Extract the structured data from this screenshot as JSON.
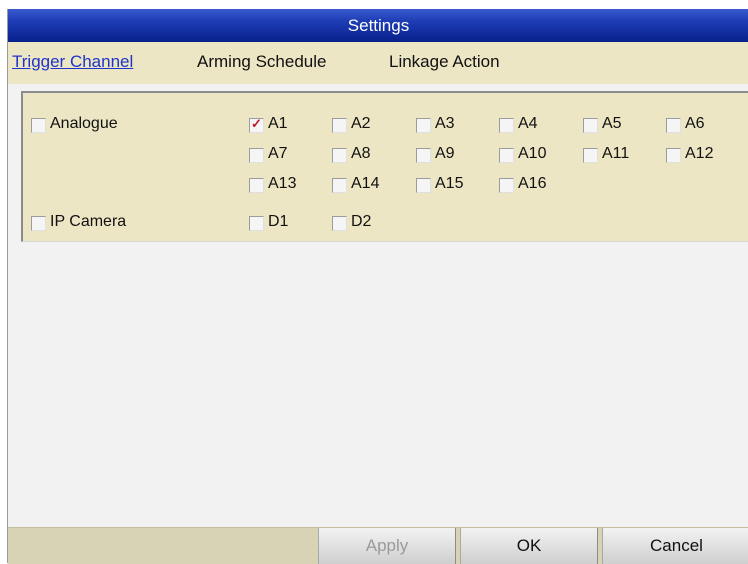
{
  "window": {
    "title": "Settings"
  },
  "tabs": [
    {
      "label": "Trigger Channel",
      "active": true
    },
    {
      "label": "Arming Schedule",
      "active": false
    },
    {
      "label": "Linkage Action",
      "active": false
    }
  ],
  "analogue": {
    "label": "Analogue",
    "checked": false,
    "channels": [
      {
        "label": "A1",
        "checked": true
      },
      {
        "label": "A2",
        "checked": false
      },
      {
        "label": "A3",
        "checked": false
      },
      {
        "label": "A4",
        "checked": false
      },
      {
        "label": "A5",
        "checked": false
      },
      {
        "label": "A6",
        "checked": false
      },
      {
        "label": "A7",
        "checked": false
      },
      {
        "label": "A8",
        "checked": false
      },
      {
        "label": "A9",
        "checked": false
      },
      {
        "label": "A10",
        "checked": false
      },
      {
        "label": "A11",
        "checked": false
      },
      {
        "label": "A12",
        "checked": false
      },
      {
        "label": "A13",
        "checked": false
      },
      {
        "label": "A14",
        "checked": false
      },
      {
        "label": "A15",
        "checked": false
      },
      {
        "label": "A16",
        "checked": false
      }
    ]
  },
  "ip_camera": {
    "label": "IP Camera",
    "checked": false,
    "channels": [
      {
        "label": "D1",
        "checked": false
      },
      {
        "label": "D2",
        "checked": false
      }
    ]
  },
  "buttons": {
    "apply": {
      "label": "Apply",
      "enabled": false
    },
    "ok": {
      "label": "OK",
      "enabled": true
    },
    "cancel": {
      "label": "Cancel",
      "enabled": true
    }
  },
  "colors": {
    "titlebar": "#1f3eb6",
    "tab_active": "#1f34c8",
    "panel": "#ece6c4",
    "check_mark": "#c0182c"
  }
}
